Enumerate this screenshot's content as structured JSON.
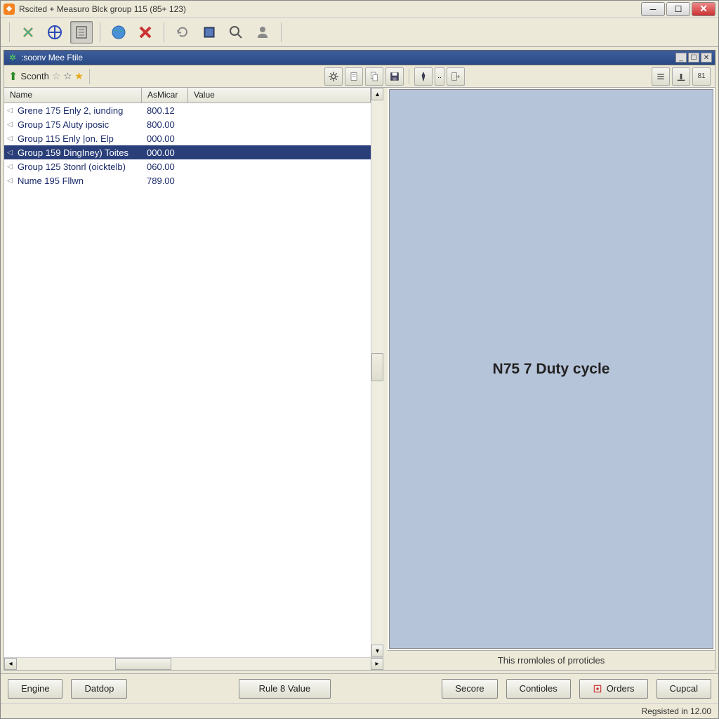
{
  "titlebar": {
    "text": "Rscited + Measuro Blck group 115 (85+ 123)"
  },
  "subwindow": {
    "title": ":soonv Mee Ftile"
  },
  "subtoolbar": {
    "label": "Sconth"
  },
  "table": {
    "columns": {
      "name": "Name",
      "asmicar": "AsMicar",
      "value": "Value"
    },
    "rows": [
      {
        "name": "Grene 175 Enly 2, iunding",
        "value": "800.12",
        "selected": false
      },
      {
        "name": "Group 175 Aluty iposic",
        "value": "800.00",
        "selected": false
      },
      {
        "name": "Group 115 Enly |on. Elp",
        "value": "000.00",
        "selected": false
      },
      {
        "name": "Group 159 DingIney) Toites",
        "value": "000.00",
        "selected": true
      },
      {
        "name": "Group 125 3tonrl (oicktelb)",
        "value": "060.00",
        "selected": false
      },
      {
        "name": "Nume 195 Fllwn",
        "value": "789.00",
        "selected": false
      }
    ]
  },
  "canvas": {
    "text": "N75 7 Duty cycle"
  },
  "right_footer": "This rromloles of prroticles",
  "bottom_buttons": {
    "engine": "Engine",
    "datdop": "Datdop",
    "rule": "Rule 8 Value",
    "secore": "Secore",
    "contoles": "Contioles",
    "orders": "Orders",
    "cupcal": "Cupcal"
  },
  "status": "Regsisted in 12.00"
}
